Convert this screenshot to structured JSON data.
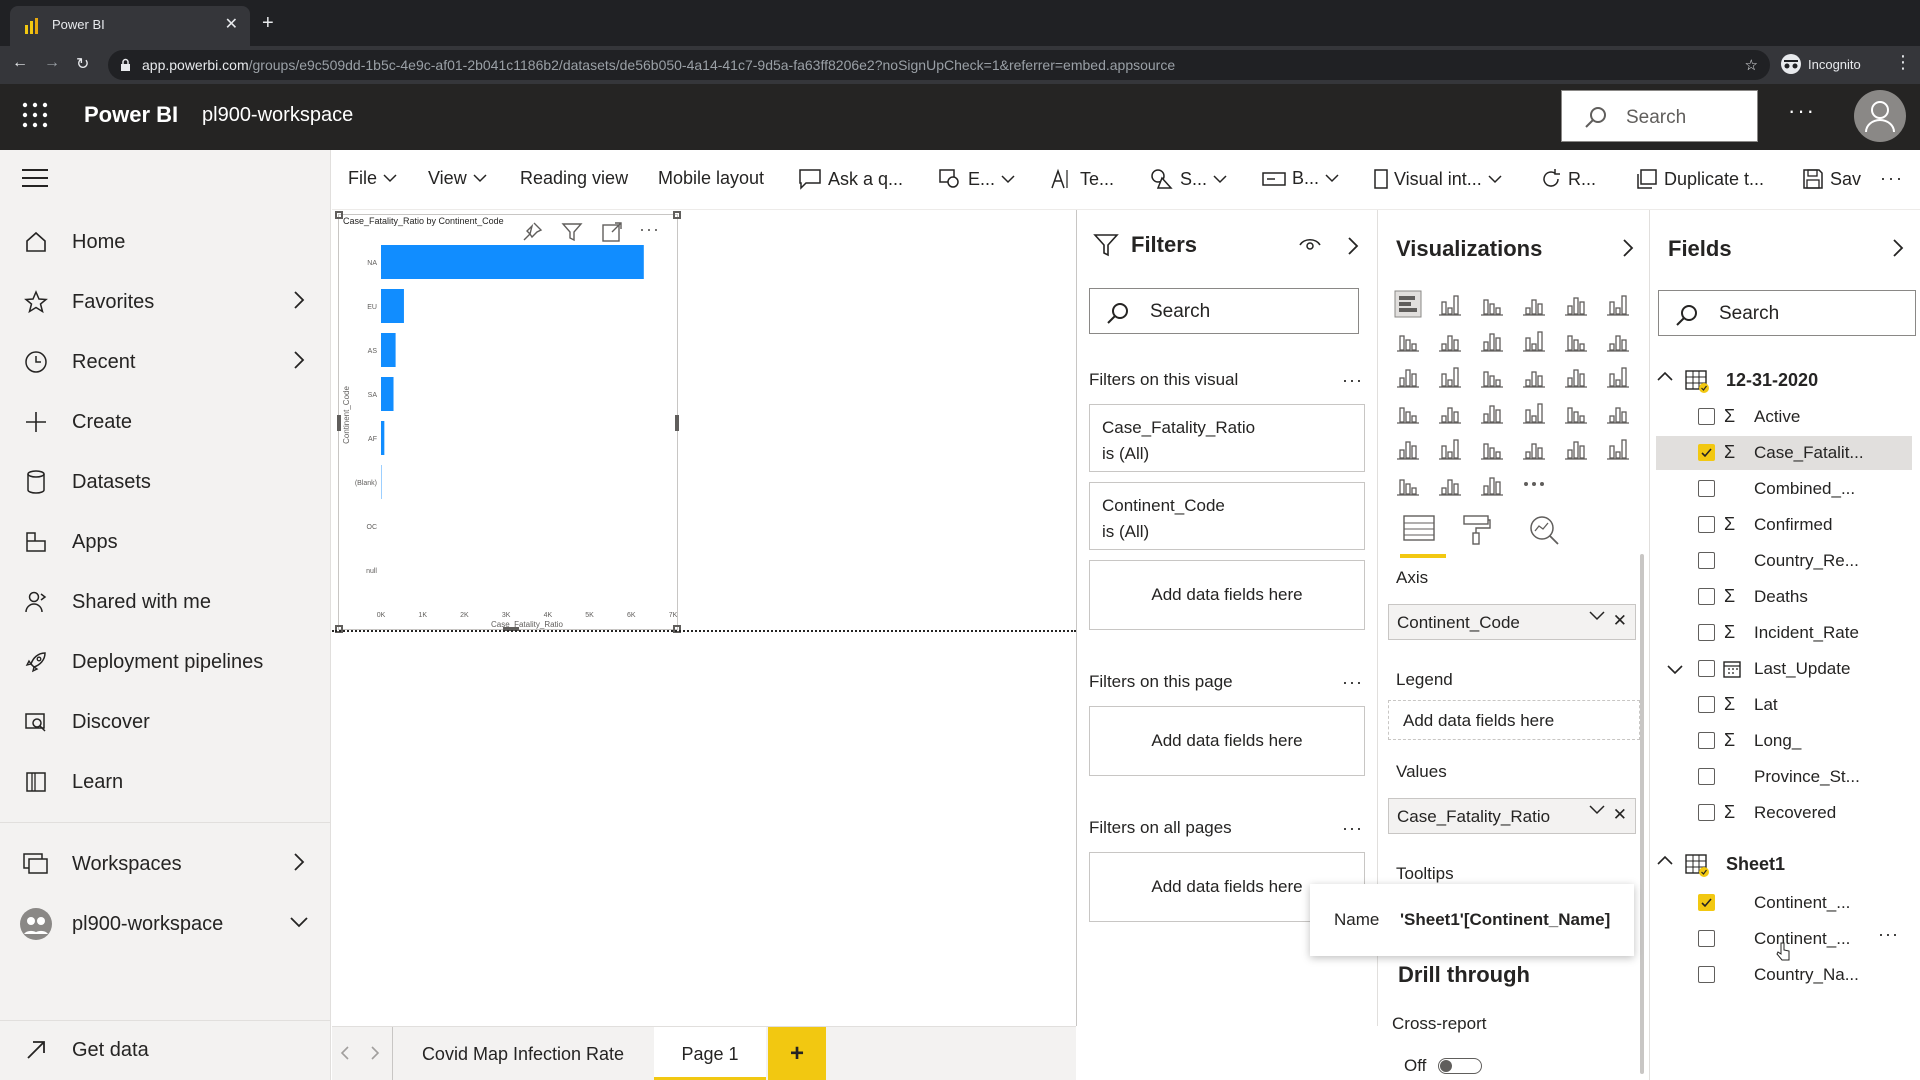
{
  "browser": {
    "tab_title": "Power BI",
    "url_host": "app.powerbi.com",
    "url_path": "/groups/e9c509dd-1b5c-4e9c-af01-2b041c1186b2/datasets/de56b050-4a14-41c7-9d5a-fa63ff8206e2?noSignUpCheck=1&referrer=embed.appsource",
    "incognito_label": "Incognito"
  },
  "header": {
    "app_name": "Power BI",
    "workspace": "pl900-workspace",
    "search_label": "Search",
    "more": "···"
  },
  "nav": {
    "items": [
      {
        "label": "Home",
        "icon": "home-icon"
      },
      {
        "label": "Favorites",
        "icon": "star-icon"
      },
      {
        "label": "Recent",
        "icon": "clock-icon"
      },
      {
        "label": "Create",
        "icon": "plus-icon"
      },
      {
        "label": "Datasets",
        "icon": "database-icon"
      },
      {
        "label": "Apps",
        "icon": "apps-icon"
      },
      {
        "label": "Shared with me",
        "icon": "person-icon"
      },
      {
        "label": "Deployment pipelines",
        "icon": "rocket-icon"
      },
      {
        "label": "Discover",
        "icon": "discover-icon"
      },
      {
        "label": "Learn",
        "icon": "book-icon"
      }
    ],
    "workspaces_label": "Workspaces",
    "current_workspace": "pl900-workspace",
    "get_data": "Get data"
  },
  "ribbon": {
    "file": "File",
    "view": "View",
    "reading_view": "Reading view",
    "mobile_layout": "Mobile layout",
    "ask": "Ask a q...",
    "explore": "E...",
    "text": "Te...",
    "shapes": "S...",
    "buttons": "B...",
    "visual_interactions": "Visual int...",
    "refresh": "R...",
    "duplicate": "Duplicate t...",
    "save": "Sav",
    "more": "···"
  },
  "chart_data": {
    "type": "bar",
    "orientation": "horizontal",
    "title": "Case_Fatality_Ratio by Continent_Code",
    "xlabel": "Case_Fatality_Ratio",
    "ylabel": "Continent_Code",
    "categories": [
      "NA",
      "EU",
      "AS",
      "SA",
      "AF",
      "(Blank)",
      "OC",
      "null"
    ],
    "values": [
      6.3,
      0.55,
      0.35,
      0.3,
      0.08,
      0.01,
      0.0,
      0.0
    ],
    "xlim": [
      0,
      7
    ],
    "xticks": [
      "0K",
      "1K",
      "2K",
      "3K",
      "4K",
      "5K",
      "6K",
      "7K"
    ],
    "bar_color": "#118DFF"
  },
  "filters": {
    "title": "Filters",
    "search": "Search",
    "on_visual": "Filters on this visual",
    "card1_line1": "Case_Fatality_Ratio",
    "card1_line2": "is (All)",
    "card2_line1": "Continent_Code",
    "card2_line2": "is (All)",
    "add_fields": "Add data fields here",
    "on_page": "Filters on this page",
    "on_all": "Filters on all pages",
    "dots": "···"
  },
  "viz": {
    "title": "Visualizations",
    "axis": "Axis",
    "axis_field": "Continent_Code",
    "legend": "Legend",
    "legend_drop": "Add data fields here",
    "values": "Values",
    "values_field": "Case_Fatality_Ratio",
    "tooltips": "Tooltips",
    "drill_through": "Drill through",
    "cross_report": "Cross-report",
    "toggle_off": "Off"
  },
  "tooltip": {
    "key": "Name",
    "value": "'Sheet1'[Continent_Name]"
  },
  "fields": {
    "title": "Fields",
    "search": "Search",
    "table1": "12-31-2020",
    "table1_fields": [
      {
        "name": "Active",
        "sigma": true,
        "checked": false
      },
      {
        "name": "Case_Fatalit...",
        "sigma": true,
        "checked": true
      },
      {
        "name": "Combined_...",
        "sigma": false,
        "checked": false
      },
      {
        "name": "Confirmed",
        "sigma": true,
        "checked": false
      },
      {
        "name": "Country_Re...",
        "sigma": false,
        "checked": false
      },
      {
        "name": "Deaths",
        "sigma": true,
        "checked": false
      },
      {
        "name": "Incident_Rate",
        "sigma": true,
        "checked": false
      },
      {
        "name": "Last_Update",
        "sigma": false,
        "checked": false
      },
      {
        "name": "Lat",
        "sigma": true,
        "checked": false
      },
      {
        "name": "Long_",
        "sigma": true,
        "checked": false
      },
      {
        "name": "Province_St...",
        "sigma": false,
        "checked": false
      },
      {
        "name": "Recovered",
        "sigma": true,
        "checked": false
      }
    ],
    "table2": "Sheet1",
    "table2_fields": [
      {
        "name": "Continent_...",
        "checked": true
      },
      {
        "name": "Continent_...",
        "checked": false
      },
      {
        "name": "Country_Na...",
        "checked": false
      }
    ],
    "dots": "···"
  },
  "pages": {
    "tab1": "Covid Map Infection Rate",
    "tab2": "Page 1",
    "add": "+"
  },
  "colors": {
    "accent": "#F2C811",
    "header_bg": "#252423",
    "bar": "#118DFF"
  }
}
